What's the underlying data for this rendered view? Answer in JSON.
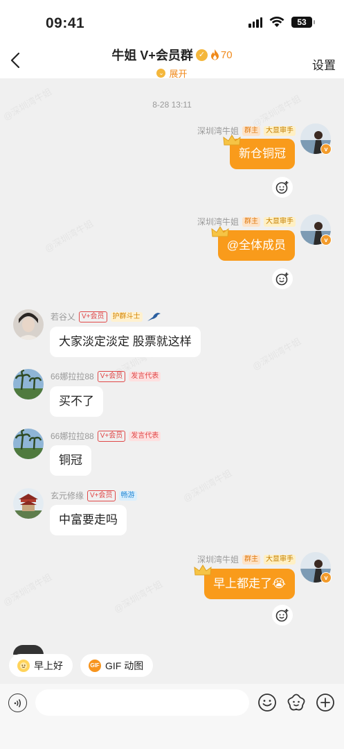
{
  "status_bar": {
    "time": "09:41",
    "battery": "53"
  },
  "header": {
    "title": "牛姐 V+会员群",
    "fire_count": "70",
    "expand_label": "展开",
    "settings_label": "设置"
  },
  "timestamp": "8-28 13:11",
  "tags": {
    "owner": "群主",
    "review": "大显审手",
    "vip": "V+会员",
    "guard": "护群斗士",
    "speak": "发言代表",
    "roam": "畅游"
  },
  "messages": [
    {
      "sender": "深圳湾牛姐",
      "text": "新仓铜冠"
    },
    {
      "sender": "深圳湾牛姐",
      "text": "@全体成员"
    },
    {
      "sender": "若谷乂",
      "text": "大家淡定淡定  股票就这样"
    },
    {
      "sender": "66娜拉拉88",
      "text": "买不了"
    },
    {
      "sender": "66娜拉拉88",
      "text": "铜冠"
    },
    {
      "sender": "玄元修缘",
      "text": "中富要走吗"
    },
    {
      "sender": "深圳湾牛姐",
      "text": "早上都走了😭"
    }
  ],
  "quick_replies": [
    {
      "label": "早上好",
      "icon": "sun-face-icon"
    },
    {
      "label": "GIF 动图",
      "icon": "gif-icon",
      "icon_text": "GIF"
    }
  ],
  "input": {
    "placeholder": ""
  },
  "colors": {
    "accent": "#f99b1b",
    "background": "#f0f0f0"
  }
}
